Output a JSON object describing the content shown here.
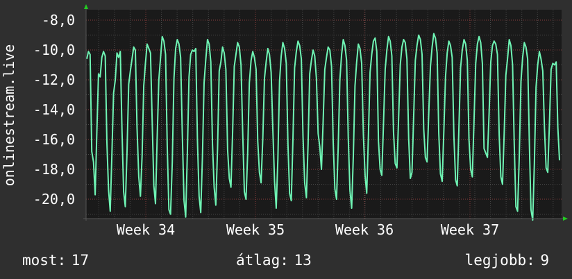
{
  "chart_data": {
    "type": "line",
    "ylabel": "onlinestream.live",
    "xlabel": "",
    "title": "",
    "x_ticks": [
      "Week 34",
      "Week 35",
      "Week 36",
      "Week 37"
    ],
    "y_ticks": [
      "-8,0",
      "-10,0",
      "-12,0",
      "-14,0",
      "-16,0",
      "-18,0",
      "-20,0"
    ],
    "ylim": [
      -21.3,
      -7.3
    ],
    "grid": true,
    "colors": {
      "background": "#2f2f2f",
      "plot": "#1a1a1a",
      "line": "#6ff4b4",
      "grid": "#8a3c3c",
      "axis_arrow": "#22cc22"
    },
    "series": [
      {
        "values": [
          -10.6,
          -10.1,
          -10.3,
          -16.8,
          -17.5,
          -19.7,
          -15.5,
          -11.6,
          -11.8,
          -10.5,
          -10.1,
          -10.4,
          -16.2,
          -19.4,
          -20.8,
          -17.0,
          -12.9,
          -12.0,
          -10.2,
          -10.5,
          -10.1,
          -15.3,
          -19.5,
          -20.5,
          -16.8,
          -12.3,
          -11.4,
          -10.6,
          -9.8,
          -10.0,
          -15.2,
          -18.5,
          -19.8,
          -17.1,
          -12.4,
          -10.9,
          -9.6,
          -9.9,
          -10.2,
          -14.7,
          -19.1,
          -20.3,
          -15.9,
          -12.0,
          -10.5,
          -9.1,
          -9.4,
          -10.3,
          -16.4,
          -20.7,
          -21.0,
          -17.5,
          -11.9,
          -9.9,
          -9.3,
          -9.6,
          -10.5,
          -15.6,
          -20.1,
          -21.2,
          -16.9,
          -11.8,
          -10.3,
          -10.0,
          -10.1,
          -9.9,
          -16.0,
          -19.8,
          -20.9,
          -17.2,
          -12.2,
          -10.6,
          -9.3,
          -9.6,
          -10.8,
          -16.3,
          -19.2,
          -20.4,
          -16.6,
          -11.4,
          -10.8,
          -9.8,
          -10.2,
          -11.3,
          -16.7,
          -18.6,
          -19.2,
          -15.5,
          -11.1,
          -10.3,
          -9.5,
          -9.8,
          -11.0,
          -15.5,
          -19.5,
          -20.0,
          -16.9,
          -12.2,
          -10.7,
          -10.1,
          -10.5,
          -11.3,
          -16.1,
          -18.2,
          -18.9,
          -15.9,
          -11.9,
          -10.8,
          -9.9,
          -10.3,
          -11.5,
          -15.4,
          -18.8,
          -20.6,
          -17.3,
          -12.1,
          -10.4,
          -9.5,
          -9.9,
          -10.9,
          -16.3,
          -19.6,
          -20.1,
          -16.0,
          -11.2,
          -10.1,
          -9.4,
          -9.7,
          -10.6,
          -15.8,
          -18.9,
          -19.9,
          -16.3,
          -11.6,
          -10.7,
          -10.0,
          -10.4,
          -11.9,
          -15.6,
          -16.5,
          -18.0,
          -14.8,
          -11.3,
          -10.5,
          -9.8,
          -10.0,
          -11.1,
          -16.2,
          -19.3,
          -20.0,
          -16.5,
          -12.0,
          -10.3,
          -9.3,
          -9.7,
          -10.7,
          -15.9,
          -19.4,
          -20.6,
          -17.1,
          -12.4,
          -10.8,
          -9.6,
          -9.9,
          -10.9,
          -15.7,
          -18.4,
          -19.6,
          -15.8,
          -11.5,
          -10.3,
          -9.4,
          -9.2,
          -10.1,
          -16.1,
          -18.0,
          -18.4,
          -15.0,
          -11.3,
          -10.0,
          -9.1,
          -9.4,
          -10.4,
          -15.5,
          -17.6,
          -17.9,
          -14.6,
          -11.0,
          -9.8,
          -9.3,
          -9.5,
          -10.6,
          -15.9,
          -18.6,
          -18.2,
          -14.5,
          -10.7,
          -9.7,
          -9.0,
          -9.3,
          -10.3,
          -15.3,
          -17.2,
          -17.5,
          -14.3,
          -11.1,
          -9.8,
          -8.9,
          -9.2,
          -10.2,
          -15.6,
          -18.3,
          -18.8,
          -15.4,
          -11.8,
          -10.2,
          -9.4,
          -9.7,
          -10.5,
          -15.8,
          -18.7,
          -19.1,
          -15.2,
          -11.2,
          -10.0,
          -9.3,
          -9.6,
          -10.7,
          -16.0,
          -18.0,
          -18.5,
          -14.8,
          -10.9,
          -9.6,
          -9.1,
          -9.5,
          -10.9,
          -16.6,
          -16.9,
          -17.2,
          -14.2,
          -10.8,
          -9.7,
          -9.4,
          -9.6,
          -10.3,
          -15.7,
          -18.5,
          -19.0,
          -15.6,
          -11.7,
          -10.6,
          -9.3,
          -9.7,
          -11.0,
          -16.3,
          -20.5,
          -20.8,
          -17.2,
          -12.1,
          -10.5,
          -9.5,
          -9.8,
          -10.6,
          -16.1,
          -20.7,
          -21.4,
          -17.6,
          -12.5,
          -11.0,
          -10.1,
          -10.6,
          -11.4,
          -15.2,
          -17.9,
          -18.2,
          -14.9,
          -11.3,
          -10.9,
          -11.0,
          -10.8,
          -15.2,
          -17.4
        ]
      }
    ]
  },
  "stats": {
    "now_label": "most:",
    "now_value": "17",
    "avg_label": "átlag:",
    "avg_value": "13",
    "max_label": "legjobb:",
    "max_value": "9"
  }
}
